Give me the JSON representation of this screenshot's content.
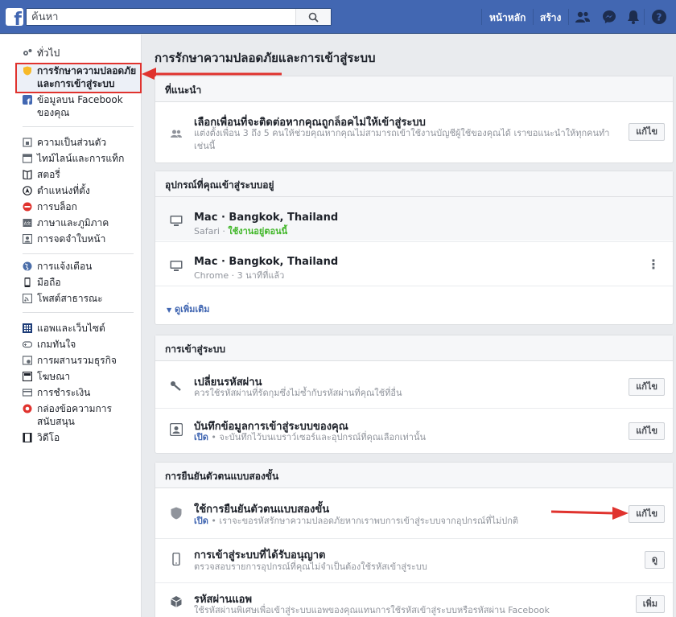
{
  "topbar": {
    "logo": "f",
    "search_placeholder": "ค้นหา",
    "nav_home": "หน้าหลัก",
    "nav_create": "สร้าง",
    "icons": [
      "friends-icon",
      "messenger-icon",
      "notifications-icon",
      "help-icon"
    ]
  },
  "sidebar": {
    "items": [
      {
        "label": "ทั่วไป",
        "icon": "gear-icon"
      },
      {
        "label": "การรักษาความปลอดภัยและการเข้าสู่ระบบ",
        "icon": "shield-icon"
      },
      {
        "label": "ข้อมูลบน Facebook ของคุณ",
        "icon": "facebook-icon"
      },
      {
        "label": "ความเป็นส่วนตัว",
        "icon": "lock-icon"
      },
      {
        "label": "ไทม์ไลน์และการแท็ก",
        "icon": "timeline-icon"
      },
      {
        "label": "สตอรี่",
        "icon": "book-icon"
      },
      {
        "label": "ตำแหน่งที่ตั้ง",
        "icon": "location-icon"
      },
      {
        "label": "การบล็อก",
        "icon": "block-icon"
      },
      {
        "label": "ภาษาและภูมิภาค",
        "icon": "language-icon"
      },
      {
        "label": "การจดจำใบหน้า",
        "icon": "face-icon"
      },
      {
        "label": "การแจ้งเตือน",
        "icon": "globe-icon"
      },
      {
        "label": "มือถือ",
        "icon": "mobile-icon"
      },
      {
        "label": "โพสต์สาธารณะ",
        "icon": "rss-icon"
      },
      {
        "label": "แอพและเว็บไซต์",
        "icon": "apps-icon"
      },
      {
        "label": "เกมทันใจ",
        "icon": "gamepad-icon"
      },
      {
        "label": "การผสานรวมธุรกิจ",
        "icon": "business-icon"
      },
      {
        "label": "โฆษณา",
        "icon": "ads-icon"
      },
      {
        "label": "การชำระเงิน",
        "icon": "payment-icon"
      },
      {
        "label": "กล่องข้อความการสนับสนุน",
        "icon": "support-icon"
      },
      {
        "label": "วิดีโอ",
        "icon": "video-icon"
      }
    ]
  },
  "main": {
    "title": "การรักษาความปลอดภัยและการเข้าสู่ระบบ",
    "recommended": {
      "header": "ที่แนะนำ",
      "title": "เลือกเพื่อนที่จะติดต่อหากคุณถูกล็อคไม่ให้เข้าสู่ระบบ",
      "sub1": "แต่งตั้งเพื่อน 3 ถึง 5 คนให้ช่วยคุณหากคุณไม่สามารถเข้าใช้งานบัญชีผู้ใช้ของคุณได้ เราขอแนะนำให้ทุกคนทำ",
      "sub2": "เช่นนี้",
      "button": "แก้ไข"
    },
    "devices": {
      "header": "อุปกรณ์ที่คุณเข้าสู่ระบบอยู่",
      "items": [
        {
          "title": "Mac · Bangkok, Thailand",
          "browser": "Safari · ",
          "status": "ใช้งานอยู่ตอนนี้"
        },
        {
          "title": "Mac · Bangkok, Thailand",
          "browser": "Chrome · 3 นาทีที่แล้ว",
          "status": ""
        }
      ],
      "see_more": "ดูเพิ่มเติม"
    },
    "login": {
      "header": "การเข้าสู่ระบบ",
      "change_password_title": "เปลี่ยนรหัสผ่าน",
      "change_password_sub": "ควรใช้รหัสผ่านที่รัดกุมซึ่งไม่ซ้ำกับรหัสผ่านที่คุณใช้ที่อื่น",
      "save_login_title": "บันทึกข้อมูลการเข้าสู่ระบบของคุณ",
      "save_login_status": "เปิด",
      "save_login_sub": " • จะบันทึกไว้บนเบราว์เซอร์และอุปกรณ์ที่คุณเลือกเท่านั้น",
      "button": "แก้ไข"
    },
    "two_factor": {
      "header": "การยืนยันตัวตนแบบสองขั้น",
      "use_title": "ใช้การยืนยันตัวตนแบบสองขั้น",
      "use_status": "เปิด",
      "use_sub": " • เราจะขอรหัสรักษาความปลอดภัยหากเราพบการเข้าสู่ระบบจากอุปกรณ์ที่ไม่ปกติ",
      "use_button": "แก้ไข",
      "authorized_title": "การเข้าสู่ระบบที่ได้รับอนุญาต",
      "authorized_sub": "ตรวจสอบรายการอุปกรณ์ที่คุณไม่จำเป็นต้องใช้รหัสเข้าสู่ระบบ",
      "authorized_button": "ดู",
      "app_pw_title": "รหัสผ่านแอพ",
      "app_pw_sub": "ใช้รหัสผ่านพิเศษเพื่อเข้าสู่ระบบแอพของคุณแทนการใช้รหัสเข้าสู่ระบบหรือรหัสผ่าน Facebook",
      "app_pw_button": "เพิ่ม"
    }
  },
  "colors": {
    "brand": "#4267b2",
    "annotation": "#e0332e",
    "active_green": "#42b72a"
  }
}
